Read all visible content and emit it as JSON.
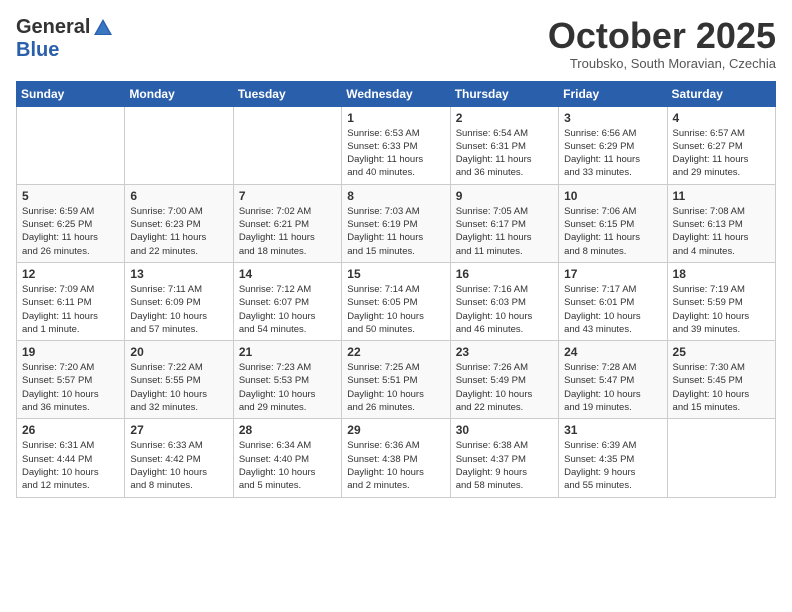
{
  "header": {
    "logo": {
      "line1": "General",
      "line2": "Blue"
    },
    "title": "October 2025",
    "subtitle": "Troubsko, South Moravian, Czechia"
  },
  "weekdays": [
    "Sunday",
    "Monday",
    "Tuesday",
    "Wednesday",
    "Thursday",
    "Friday",
    "Saturday"
  ],
  "weeks": [
    [
      {
        "day": "",
        "info": ""
      },
      {
        "day": "",
        "info": ""
      },
      {
        "day": "",
        "info": ""
      },
      {
        "day": "1",
        "info": "Sunrise: 6:53 AM\nSunset: 6:33 PM\nDaylight: 11 hours\nand 40 minutes."
      },
      {
        "day": "2",
        "info": "Sunrise: 6:54 AM\nSunset: 6:31 PM\nDaylight: 11 hours\nand 36 minutes."
      },
      {
        "day": "3",
        "info": "Sunrise: 6:56 AM\nSunset: 6:29 PM\nDaylight: 11 hours\nand 33 minutes."
      },
      {
        "day": "4",
        "info": "Sunrise: 6:57 AM\nSunset: 6:27 PM\nDaylight: 11 hours\nand 29 minutes."
      }
    ],
    [
      {
        "day": "5",
        "info": "Sunrise: 6:59 AM\nSunset: 6:25 PM\nDaylight: 11 hours\nand 26 minutes."
      },
      {
        "day": "6",
        "info": "Sunrise: 7:00 AM\nSunset: 6:23 PM\nDaylight: 11 hours\nand 22 minutes."
      },
      {
        "day": "7",
        "info": "Sunrise: 7:02 AM\nSunset: 6:21 PM\nDaylight: 11 hours\nand 18 minutes."
      },
      {
        "day": "8",
        "info": "Sunrise: 7:03 AM\nSunset: 6:19 PM\nDaylight: 11 hours\nand 15 minutes."
      },
      {
        "day": "9",
        "info": "Sunrise: 7:05 AM\nSunset: 6:17 PM\nDaylight: 11 hours\nand 11 minutes."
      },
      {
        "day": "10",
        "info": "Sunrise: 7:06 AM\nSunset: 6:15 PM\nDaylight: 11 hours\nand 8 minutes."
      },
      {
        "day": "11",
        "info": "Sunrise: 7:08 AM\nSunset: 6:13 PM\nDaylight: 11 hours\nand 4 minutes."
      }
    ],
    [
      {
        "day": "12",
        "info": "Sunrise: 7:09 AM\nSunset: 6:11 PM\nDaylight: 11 hours\nand 1 minute."
      },
      {
        "day": "13",
        "info": "Sunrise: 7:11 AM\nSunset: 6:09 PM\nDaylight: 10 hours\nand 57 minutes."
      },
      {
        "day": "14",
        "info": "Sunrise: 7:12 AM\nSunset: 6:07 PM\nDaylight: 10 hours\nand 54 minutes."
      },
      {
        "day": "15",
        "info": "Sunrise: 7:14 AM\nSunset: 6:05 PM\nDaylight: 10 hours\nand 50 minutes."
      },
      {
        "day": "16",
        "info": "Sunrise: 7:16 AM\nSunset: 6:03 PM\nDaylight: 10 hours\nand 46 minutes."
      },
      {
        "day": "17",
        "info": "Sunrise: 7:17 AM\nSunset: 6:01 PM\nDaylight: 10 hours\nand 43 minutes."
      },
      {
        "day": "18",
        "info": "Sunrise: 7:19 AM\nSunset: 5:59 PM\nDaylight: 10 hours\nand 39 minutes."
      }
    ],
    [
      {
        "day": "19",
        "info": "Sunrise: 7:20 AM\nSunset: 5:57 PM\nDaylight: 10 hours\nand 36 minutes."
      },
      {
        "day": "20",
        "info": "Sunrise: 7:22 AM\nSunset: 5:55 PM\nDaylight: 10 hours\nand 32 minutes."
      },
      {
        "day": "21",
        "info": "Sunrise: 7:23 AM\nSunset: 5:53 PM\nDaylight: 10 hours\nand 29 minutes."
      },
      {
        "day": "22",
        "info": "Sunrise: 7:25 AM\nSunset: 5:51 PM\nDaylight: 10 hours\nand 26 minutes."
      },
      {
        "day": "23",
        "info": "Sunrise: 7:26 AM\nSunset: 5:49 PM\nDaylight: 10 hours\nand 22 minutes."
      },
      {
        "day": "24",
        "info": "Sunrise: 7:28 AM\nSunset: 5:47 PM\nDaylight: 10 hours\nand 19 minutes."
      },
      {
        "day": "25",
        "info": "Sunrise: 7:30 AM\nSunset: 5:45 PM\nDaylight: 10 hours\nand 15 minutes."
      }
    ],
    [
      {
        "day": "26",
        "info": "Sunrise: 6:31 AM\nSunset: 4:44 PM\nDaylight: 10 hours\nand 12 minutes."
      },
      {
        "day": "27",
        "info": "Sunrise: 6:33 AM\nSunset: 4:42 PM\nDaylight: 10 hours\nand 8 minutes."
      },
      {
        "day": "28",
        "info": "Sunrise: 6:34 AM\nSunset: 4:40 PM\nDaylight: 10 hours\nand 5 minutes."
      },
      {
        "day": "29",
        "info": "Sunrise: 6:36 AM\nSunset: 4:38 PM\nDaylight: 10 hours\nand 2 minutes."
      },
      {
        "day": "30",
        "info": "Sunrise: 6:38 AM\nSunset: 4:37 PM\nDaylight: 9 hours\nand 58 minutes."
      },
      {
        "day": "31",
        "info": "Sunrise: 6:39 AM\nSunset: 4:35 PM\nDaylight: 9 hours\nand 55 minutes."
      },
      {
        "day": "",
        "info": ""
      }
    ]
  ]
}
